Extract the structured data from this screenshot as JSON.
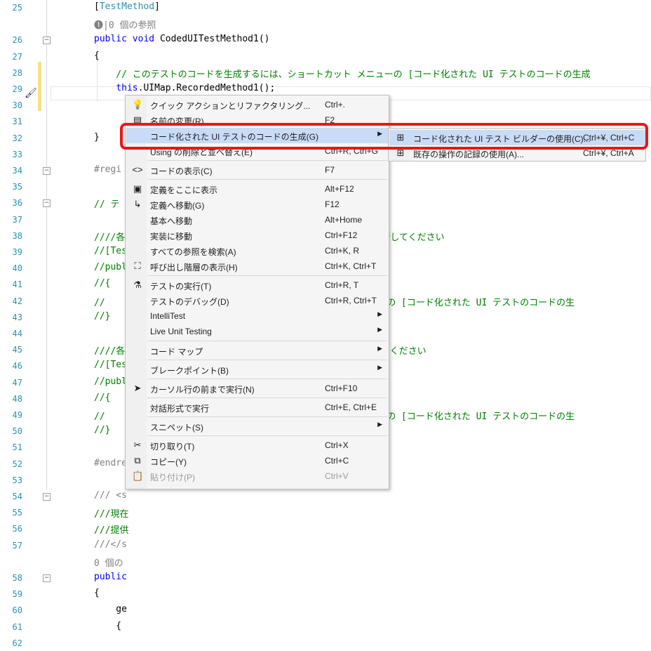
{
  "editor": {
    "lines": [
      {
        "n": "25",
        "segs": [
          {
            "t": "[",
            "c": "p"
          },
          {
            "t": "TestMethod",
            "c": "typ"
          },
          {
            "t": "]",
            "c": "p"
          }
        ]
      },
      {
        "n": "",
        "segs": [
          {
            "t": "❶|0 個の参照",
            "c": "gr"
          }
        ]
      },
      {
        "n": "26",
        "segs": [
          {
            "t": "public ",
            "c": "kw"
          },
          {
            "t": "void ",
            "c": "kw"
          },
          {
            "t": "CodedUITestMethod1()",
            "c": "p"
          }
        ]
      },
      {
        "n": "27",
        "segs": [
          {
            "t": "{",
            "c": "p"
          }
        ]
      },
      {
        "n": "28",
        "segs": [
          {
            "t": "    // このテストのコードを生成するには、ショートカット メニューの [コード化された UI テストのコードの生成",
            "c": "cm"
          }
        ]
      },
      {
        "n": "29",
        "segs": [
          {
            "t": "    ",
            "c": "p"
          },
          {
            "t": "this",
            "c": "kw"
          },
          {
            "t": ".UIMap.RecordedMethod1();",
            "c": "p"
          }
        ]
      },
      {
        "n": "30",
        "segs": []
      },
      {
        "n": "31",
        "segs": []
      },
      {
        "n": "32",
        "segs": [
          {
            "t": "}",
            "c": "p"
          }
        ]
      },
      {
        "n": "33",
        "segs": []
      },
      {
        "n": "34",
        "segs": [
          {
            "t": "#regi",
            "c": "gr"
          }
        ]
      },
      {
        "n": "35",
        "segs": []
      },
      {
        "n": "36",
        "segs": [
          {
            "t": "// テ",
            "c": "cm"
          }
        ]
      },
      {
        "n": "37",
        "segs": []
      },
      {
        "n": "38",
        "segs": [
          {
            "t": "////各",
            "c": "cm"
          },
          {
            "t": "                                        ードを実行してください",
            "c": "cm"
          }
        ]
      },
      {
        "n": "39",
        "segs": [
          {
            "t": "//[Tes",
            "c": "cm"
          }
        ]
      },
      {
        "n": "40",
        "segs": [
          {
            "t": "//publ",
            "c": "cm"
          }
        ]
      },
      {
        "n": "41",
        "segs": [
          {
            "t": "//{",
            "c": "cm"
          }
        ]
      },
      {
        "n": "42",
        "segs": [
          {
            "t": "//",
            "c": "cm"
          },
          {
            "t": "                                          ト メニューの [コード化された UI テストのコードの生",
            "c": "cm"
          }
        ]
      },
      {
        "n": "43",
        "segs": [
          {
            "t": "//}",
            "c": "cm"
          }
        ]
      },
      {
        "n": "44",
        "segs": []
      },
      {
        "n": "45",
        "segs": [
          {
            "t": "////各",
            "c": "cm"
          },
          {
            "t": "                                        を実行してください",
            "c": "cm"
          }
        ]
      },
      {
        "n": "46",
        "segs": [
          {
            "t": "//[Tes",
            "c": "cm"
          }
        ]
      },
      {
        "n": "47",
        "segs": [
          {
            "t": "//publ",
            "c": "cm"
          }
        ]
      },
      {
        "n": "48",
        "segs": [
          {
            "t": "//{",
            "c": "cm"
          }
        ]
      },
      {
        "n": "49",
        "segs": [
          {
            "t": "//",
            "c": "cm"
          },
          {
            "t": "                                          ト メニューの [コード化された UI テストのコードの生",
            "c": "cm"
          }
        ]
      },
      {
        "n": "50",
        "segs": [
          {
            "t": "//}",
            "c": "cm"
          }
        ]
      },
      {
        "n": "51",
        "segs": []
      },
      {
        "n": "52",
        "segs": [
          {
            "t": "#endre",
            "c": "gr"
          }
        ]
      },
      {
        "n": "53",
        "segs": []
      },
      {
        "n": "54",
        "segs": [
          {
            "t": "/// <s",
            "c": "gr"
          }
        ]
      },
      {
        "n": "55",
        "segs": [
          {
            "t": "///現在",
            "c": "cm"
          }
        ]
      },
      {
        "n": "56",
        "segs": [
          {
            "t": "///提供",
            "c": "cm"
          }
        ]
      },
      {
        "n": "57",
        "segs": [
          {
            "t": "///</s",
            "c": "gr"
          }
        ]
      },
      {
        "n": "",
        "segs": [
          {
            "t": "0 個の",
            "c": "gr"
          }
        ]
      },
      {
        "n": "58",
        "segs": [
          {
            "t": "public",
            "c": "kw"
          }
        ]
      },
      {
        "n": "59",
        "segs": [
          {
            "t": "{",
            "c": "p"
          }
        ]
      },
      {
        "n": "60",
        "segs": [
          {
            "t": "    ge",
            "c": "p"
          }
        ]
      },
      {
        "n": "61",
        "segs": [
          {
            "t": "    {",
            "c": "p"
          }
        ]
      },
      {
        "n": "62",
        "segs": []
      }
    ]
  },
  "menu": {
    "items": [
      {
        "type": "item",
        "icon": "lightbulb-icon",
        "glyph": "💡",
        "label": "クイック アクションとリファクタリング...",
        "shortcut": "Ctrl+.",
        "arrow": false,
        "disabled": false
      },
      {
        "type": "item",
        "icon": "rename-icon",
        "glyph": "▤",
        "label": "名前の変更(R)...",
        "shortcut": "F2",
        "arrow": false,
        "disabled": false
      },
      {
        "type": "item",
        "icon": "",
        "glyph": "",
        "label": "コード化された UI テストのコードの生成(G)",
        "shortcut": "",
        "arrow": true,
        "disabled": false,
        "highlight": true
      },
      {
        "type": "item",
        "icon": "",
        "glyph": "",
        "label": "Using の削除と並べ替え(E)",
        "shortcut": "Ctrl+R, Ctrl+G",
        "arrow": false,
        "disabled": false
      },
      {
        "type": "sep"
      },
      {
        "type": "item",
        "icon": "code-view-icon",
        "glyph": "<>",
        "label": "コードの表示(C)",
        "shortcut": "F7",
        "arrow": false,
        "disabled": false
      },
      {
        "type": "sep"
      },
      {
        "type": "item",
        "icon": "peek-definition-icon",
        "glyph": "▣",
        "label": "定義をここに表示",
        "shortcut": "Alt+F12",
        "arrow": false,
        "disabled": false
      },
      {
        "type": "item",
        "icon": "goto-definition-icon",
        "glyph": "↳",
        "label": "定義へ移動(G)",
        "shortcut": "F12",
        "arrow": false,
        "disabled": false
      },
      {
        "type": "item",
        "icon": "",
        "glyph": "",
        "label": "基本へ移動",
        "shortcut": "Alt+Home",
        "arrow": false,
        "disabled": false
      },
      {
        "type": "item",
        "icon": "",
        "glyph": "",
        "label": "実装に移動",
        "shortcut": "Ctrl+F12",
        "arrow": false,
        "disabled": false
      },
      {
        "type": "item",
        "icon": "",
        "glyph": "",
        "label": "すべての参照を検索(A)",
        "shortcut": "Ctrl+K, R",
        "arrow": false,
        "disabled": false
      },
      {
        "type": "item",
        "icon": "call-hierarchy-icon",
        "glyph": "⛶",
        "label": "呼び出し階層の表示(H)",
        "shortcut": "Ctrl+K, Ctrl+T",
        "arrow": false,
        "disabled": false
      },
      {
        "type": "sep"
      },
      {
        "type": "item",
        "icon": "run-test-icon",
        "glyph": "⚗",
        "label": "テストの実行(T)",
        "shortcut": "Ctrl+R, T",
        "arrow": false,
        "disabled": false
      },
      {
        "type": "item",
        "icon": "",
        "glyph": "",
        "label": "テストのデバッグ(D)",
        "shortcut": "Ctrl+R, Ctrl+T",
        "arrow": false,
        "disabled": false
      },
      {
        "type": "item",
        "icon": "",
        "glyph": "",
        "label": "IntelliTest",
        "shortcut": "",
        "arrow": true,
        "disabled": false
      },
      {
        "type": "item",
        "icon": "",
        "glyph": "",
        "label": "Live Unit Testing",
        "shortcut": "",
        "arrow": true,
        "disabled": false
      },
      {
        "type": "sep"
      },
      {
        "type": "item",
        "icon": "",
        "glyph": "",
        "label": "コード マップ",
        "shortcut": "",
        "arrow": true,
        "disabled": false
      },
      {
        "type": "sep"
      },
      {
        "type": "item",
        "icon": "",
        "glyph": "",
        "label": "ブレークポイント(B)",
        "shortcut": "",
        "arrow": true,
        "disabled": false
      },
      {
        "type": "sep"
      },
      {
        "type": "item",
        "icon": "run-to-cursor-icon",
        "glyph": "➤",
        "label": "カーソル行の前まで実行(N)",
        "shortcut": "Ctrl+F10",
        "arrow": false,
        "disabled": false
      },
      {
        "type": "sep"
      },
      {
        "type": "item",
        "icon": "",
        "glyph": "",
        "label": "対話形式で実行",
        "shortcut": "Ctrl+E, Ctrl+E",
        "arrow": false,
        "disabled": false
      },
      {
        "type": "sep"
      },
      {
        "type": "item",
        "icon": "",
        "glyph": "",
        "label": "スニペット(S)",
        "shortcut": "",
        "arrow": true,
        "disabled": false
      },
      {
        "type": "sep"
      },
      {
        "type": "item",
        "icon": "cut-icon",
        "glyph": "✂",
        "label": "切り取り(T)",
        "shortcut": "Ctrl+X",
        "arrow": false,
        "disabled": false
      },
      {
        "type": "item",
        "icon": "copy-icon",
        "glyph": "⧉",
        "label": "コピー(Y)",
        "shortcut": "Ctrl+C",
        "arrow": false,
        "disabled": false
      },
      {
        "type": "item",
        "icon": "paste-icon",
        "glyph": "📋",
        "label": "貼り付け(P)",
        "shortcut": "Ctrl+V",
        "arrow": false,
        "disabled": true
      }
    ]
  },
  "submenu": {
    "items": [
      {
        "icon": "test-builder-icon",
        "glyph": "⊞",
        "label": "コード化された UI テスト ビルダーの使用(C)...",
        "shortcut": "Ctrl+¥, Ctrl+C"
      },
      {
        "icon": "recording-icon",
        "glyph": "⊞",
        "label": "既存の操作の記録の使用(A)...",
        "shortcut": "Ctrl+¥, Ctrl+A"
      }
    ]
  },
  "colors": {
    "highlight_box": "#e8171b",
    "menu_highlight": "#c9dcf5",
    "comment": "#008000",
    "keyword": "#0000ff",
    "type": "#2b91af"
  }
}
